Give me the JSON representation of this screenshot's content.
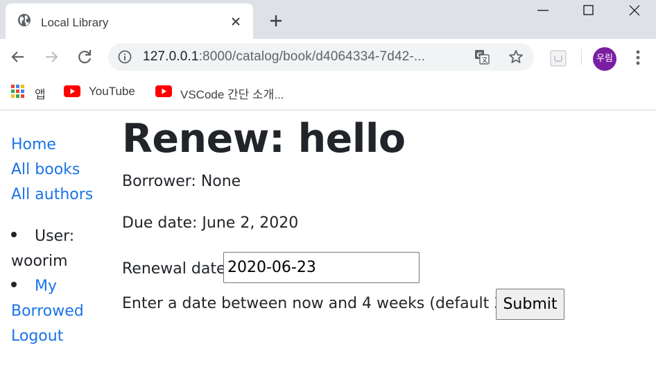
{
  "browser": {
    "tab": {
      "title": "Local Library",
      "icon": "globe-icon"
    },
    "address": {
      "host": "127.0.0.1",
      "path": ":8000/catalog/book/d4064334-7d42-..."
    },
    "profile": {
      "initials": "우림",
      "color": "#7b1fa2"
    },
    "bookmarks": [
      {
        "label": "앱",
        "icon": "apps-grid-icon"
      },
      {
        "label": "YouTube",
        "icon": "youtube-icon"
      },
      {
        "label": "VSCode 간단 소개...",
        "icon": "youtube-icon"
      }
    ]
  },
  "sidebar": {
    "links": [
      "Home",
      "All books",
      "All authors"
    ],
    "user_prefix": "User:",
    "username": "woorim",
    "my_borrowed_1": "My",
    "my_borrowed_2": "Borrowed",
    "logout": "Logout",
    "link_color": "#1a73e8"
  },
  "main": {
    "heading": "Renew: hello",
    "borrower": "Borrower: None",
    "due_date": "Due date: June 2, 2020",
    "renewal_label": "Renewal date:",
    "renewal_value": "2020-06-23",
    "help_text": "Enter a date between now and 4 weeks (default 3).",
    "submit_label": "Submit"
  }
}
